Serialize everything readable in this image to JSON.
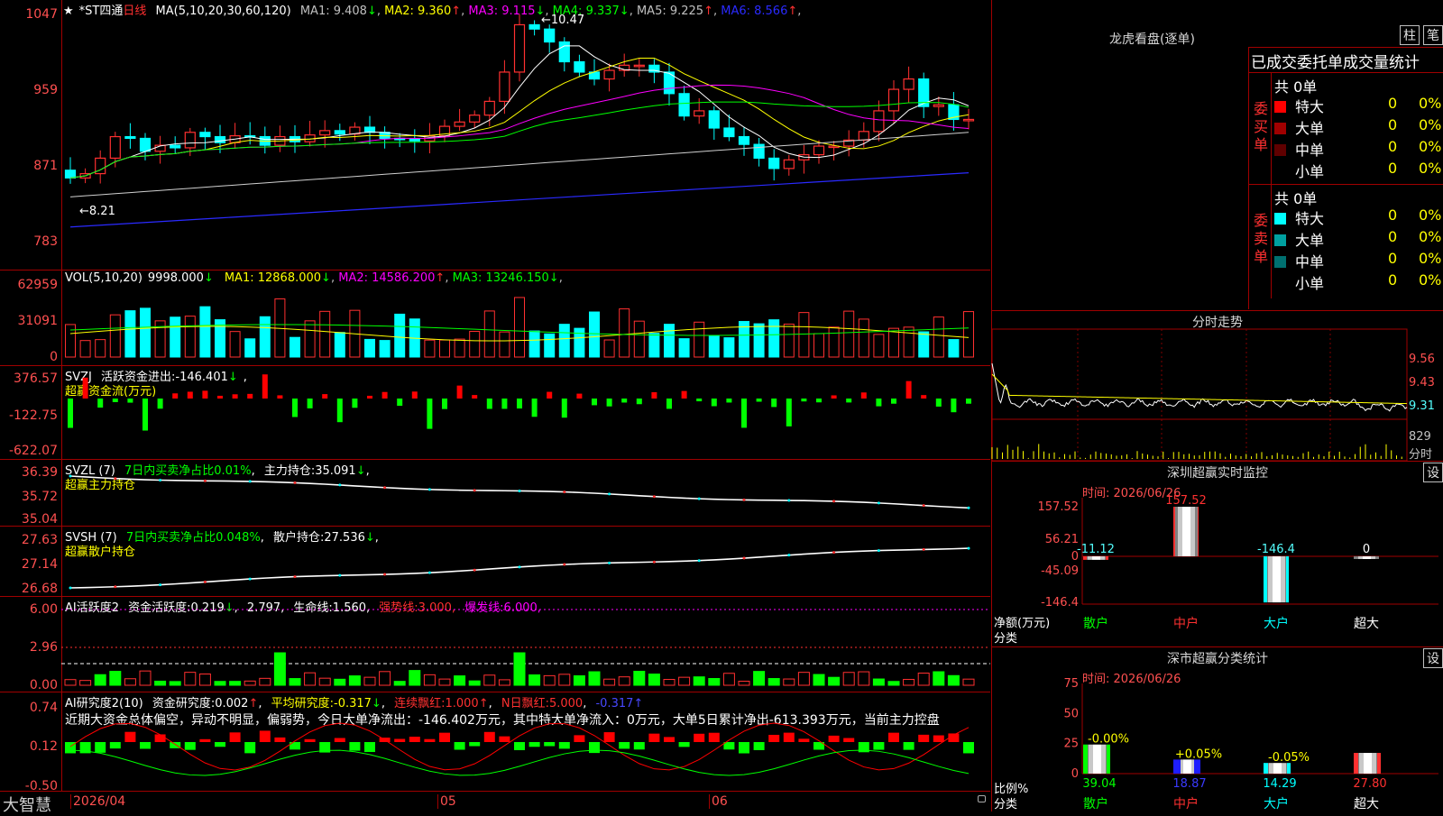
{
  "app": {
    "brand": "大智慧"
  },
  "main": {
    "star": "★",
    "name": "*ST四通",
    "period": "日线",
    "ma": {
      "label": "MA(5,10,20,30,60,120)",
      "items": [
        {
          "name": "MA1:",
          "value": "9.408",
          "arrow": "↓",
          "color": "#c0c0c0"
        },
        {
          "name": "MA2:",
          "value": "9.360",
          "arrow": "↑",
          "color": "#ffff00"
        },
        {
          "name": "MA3:",
          "value": "9.115",
          "arrow": "↓",
          "color": "#ff00ff"
        },
        {
          "name": "MA4:",
          "value": "9.337",
          "arrow": "↓",
          "color": "#00ff00"
        },
        {
          "name": "MA5:",
          "value": "9.225",
          "arrow": "↑",
          "color": "#c0c0c0"
        },
        {
          "name": "MA6:",
          "value": "8.566",
          "arrow": "↑",
          "color": "#2a2aff"
        }
      ]
    },
    "y_ticks": [
      "1047",
      "959",
      "871",
      "783"
    ],
    "high_label": "10.47",
    "low_label": "8.21"
  },
  "vol": {
    "label": "VOL(5,10,20)",
    "value": "9998.000",
    "arrow": "↓",
    "mas": [
      {
        "name": "MA1:",
        "value": "12868.000",
        "arrow": "↓",
        "color": "#ffff00"
      },
      {
        "name": "MA2:",
        "value": "14586.200",
        "arrow": "↑",
        "color": "#ff00ff"
      },
      {
        "name": "MA3:",
        "value": "13246.150",
        "arrow": "↓",
        "color": "#00ff00"
      }
    ],
    "y_ticks": [
      "62959",
      "31091",
      "0"
    ]
  },
  "svzj": {
    "label": "SVZJ",
    "desc": "活跃资金进出:",
    "value": "-146.401",
    "arrow": "↓",
    "sub": "超赢资金流(万元)",
    "y_ticks": [
      "376.57",
      "-122.75",
      "-622.07"
    ]
  },
  "svzl": {
    "label": "SVZL (7)",
    "desc": "7日内买卖净占比0.01%",
    "hold": "主力持仓:",
    "value": "35.091",
    "arrow": "↓",
    "sub": "超赢主力持仓",
    "y_ticks": [
      "36.39",
      "35.72",
      "35.04"
    ]
  },
  "svsh": {
    "label": "SVSH (7)",
    "desc": "7日内买卖净占比0.048%",
    "hold": "散户持仓:",
    "value": "27.536",
    "arrow": "↓",
    "sub": "超赢散户持仓",
    "y_ticks": [
      "27.63",
      "27.14",
      "26.68"
    ]
  },
  "ai1": {
    "label": "AI活跃度2",
    "desc": "资金活跃度:",
    "v1": "0.219",
    "a1": "↓",
    "v2": "2.797",
    "l3": "生命线:",
    "v3": "1.560",
    "l4": "强势线:",
    "v4": "3.000",
    "l5": "爆发线:",
    "v5": "6.000",
    "y_ticks": [
      "6.00",
      "2.96",
      "0.00"
    ]
  },
  "ai2": {
    "label": "AI研究度2(10)",
    "desc": "资金研究度:",
    "v1": "0.002",
    "a1": "↑",
    "l2": "平均研究度:",
    "v2": "-0.317",
    "a2": "↓",
    "l3": "连续飘红:",
    "v3": "1.000",
    "a3": "↑",
    "l4": "N日飘红:",
    "v4": "5.000",
    "v5": "-0.317",
    "a5": "↑",
    "note": "近期大资金总体偏空，异动不明显，偏弱势，今日大单净流出：-146.402万元，其中特大单净流入：0万元，大单5日累计净出-613.393万元，当前主力控盘",
    "y_ticks": [
      "0.74",
      "0.12",
      "-0.50"
    ]
  },
  "xaxis": {
    "labels": [
      "2026/04",
      "05",
      "06"
    ]
  },
  "dragon": {
    "title": "龙虎看盘(逐单)",
    "btn1": "柱",
    "btn2": "笔",
    "head": "已成交委托单成交量统计",
    "buy": {
      "label": "委买单",
      "total": "共 0单",
      "rows": [
        {
          "n": "特大",
          "v": "0",
          "p": "0%",
          "c": "#ff0000"
        },
        {
          "n": "大单",
          "v": "0",
          "p": "0%",
          "c": "#a00000"
        },
        {
          "n": "中单",
          "v": "0",
          "p": "0%",
          "c": "#600000"
        },
        {
          "n": "小单",
          "v": "0",
          "p": "0%",
          "c": ""
        }
      ]
    },
    "sell": {
      "label": "委卖单",
      "total": "共 0单",
      "rows": [
        {
          "n": "特大",
          "v": "0",
          "p": "0%",
          "c": "#00ffff"
        },
        {
          "n": "大单",
          "v": "0",
          "p": "0%",
          "c": "#00a0a0"
        },
        {
          "n": "中单",
          "v": "0",
          "p": "0%",
          "c": "#007070"
        },
        {
          "n": "小单",
          "v": "0",
          "p": "0%",
          "c": ""
        }
      ]
    }
  },
  "intraday": {
    "title": "分时走势",
    "y_ticks": [
      "9.56",
      "9.43",
      "9.31"
    ],
    "vol_label": "829",
    "vol_unit": "分时"
  },
  "monitor": {
    "title": "深圳超赢实时监控",
    "btn": "设",
    "time": "时间: 2026/06/26",
    "y_ticks": [
      "157.52",
      "56.21",
      "0",
      "-45.09",
      "-146.4"
    ],
    "ylabel": "净额(万元)",
    "xlabel": "分类",
    "chart_data": {
      "type": "bar",
      "categories": [
        "散户",
        "中户",
        "大户",
        "超大"
      ],
      "values": [
        -11.12,
        157.52,
        -146.4,
        0
      ],
      "value_labels": [
        "-11.12",
        "157.52",
        "-146.4",
        "0"
      ],
      "ylim": [
        -146.4,
        157.52
      ]
    }
  },
  "classify": {
    "title": "深市超赢分类统计",
    "btn": "设",
    "time": "时间: 2026/06/26",
    "y_ticks": [
      "75",
      "50",
      "25",
      "0"
    ],
    "ylabel": "比例%",
    "xlabel": "分类",
    "chart_data": {
      "type": "bar",
      "categories": [
        "散户",
        "中户",
        "大户",
        "超大"
      ],
      "values": [
        39.04,
        18.87,
        14.29,
        27.8
      ],
      "value_labels": [
        "39.04",
        "18.87",
        "14.29",
        "27.80"
      ],
      "change_labels": [
        "-0.00%",
        "+0.05%",
        "-0.05%",
        ""
      ],
      "ylim": [
        0,
        75
      ]
    }
  }
}
